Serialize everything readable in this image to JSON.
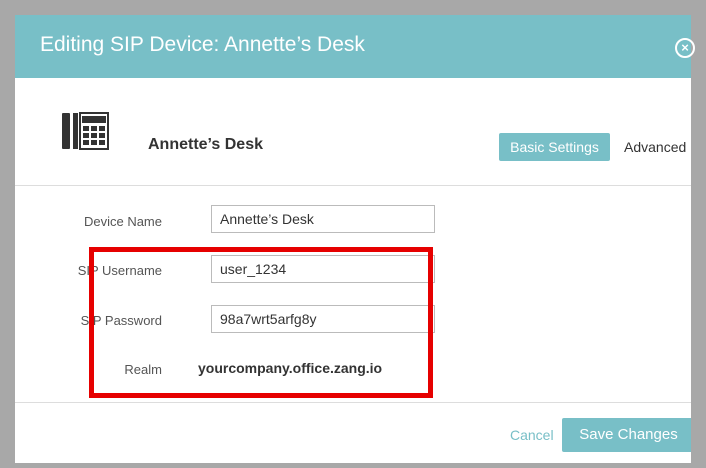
{
  "dialog": {
    "title": "Editing SIP Device: Annette’s Desk",
    "close_icon": "close-circle-icon"
  },
  "device": {
    "icon": "desk-phone-icon",
    "name": "Annette’s Desk"
  },
  "tabs": [
    {
      "label": "Basic Settings",
      "active": true
    },
    {
      "label": "Advanced",
      "active": false
    }
  ],
  "form": {
    "device_name": {
      "label": "Device Name",
      "value": "Annette’s Desk"
    },
    "sip_username": {
      "label": "SIP Username",
      "value": "user_1234"
    },
    "sip_password": {
      "label": "SIP Password",
      "value": "98a7wrt5arfg8y"
    },
    "realm": {
      "label": "Realm",
      "value": "yourcompany.office.zang.io"
    }
  },
  "footer": {
    "cancel_label": "Cancel",
    "save_label": "Save Changes"
  },
  "colors": {
    "accent": "#78bfc7",
    "highlight": "#e60000"
  }
}
